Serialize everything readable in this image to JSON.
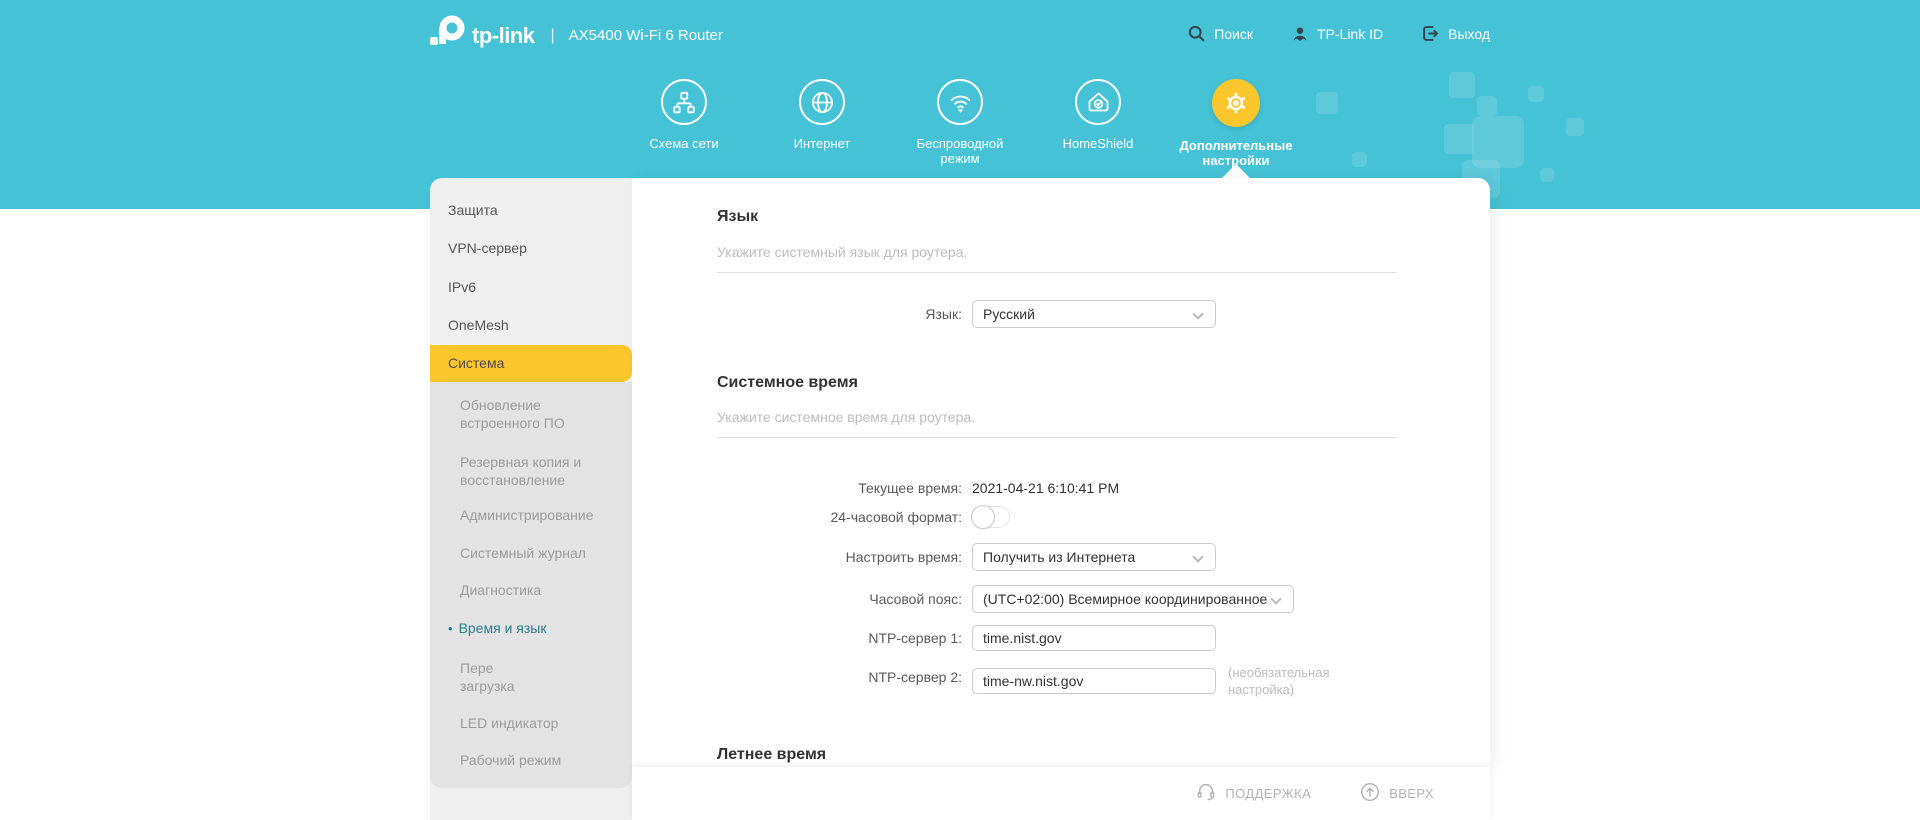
{
  "header": {
    "brand": "tp-link",
    "sep": "|",
    "model": "AX5400 Wi-Fi 6 Router",
    "search_label": "Поиск",
    "id_label": "TP-Link ID",
    "logout_label": "Выход"
  },
  "nav": {
    "items": [
      {
        "label": "Схема сети",
        "icon": "network-map-icon",
        "active": false
      },
      {
        "label": "Интернет",
        "icon": "globe-icon",
        "active": false
      },
      {
        "label": "Беспроводной режим",
        "icon": "wifi-icon",
        "active": false
      },
      {
        "label": "HomeShield",
        "icon": "home-shield-icon",
        "active": false
      },
      {
        "label": "Дополнительные настройки",
        "icon": "gear-icon",
        "active": true
      }
    ]
  },
  "sidebar": {
    "items": [
      "Защита",
      "VPN-сервер",
      "IPv6",
      "OneMesh",
      "Система"
    ],
    "active_item": "Система",
    "bullet": "•",
    "subitems": [
      "Обновление встроенного ПО",
      "Резервная копия и восстановление",
      "Администрирование",
      "Системный журнал",
      "Диагностика",
      "Время и язык",
      "Пере загрузка",
      "LED индикатор",
      "Рабочий режим"
    ],
    "active_subitem": "Время и язык"
  },
  "main": {
    "language": {
      "title": "Язык",
      "subtitle": "Укажите системный язык для роутера.",
      "label": "Язык:",
      "value": "Русский"
    },
    "time": {
      "title": "Системное время",
      "subtitle": "Укажите системное время для роутера.",
      "current_label": "Текущее время:",
      "current_value": "2021-04-21 6:10:41 PM",
      "format24_label": "24-часовой формат:",
      "format24_state": "off",
      "set_time_label": "Настроить время:",
      "set_time_value": "Получить из Интернета",
      "timezone_label": "Часовой пояс:",
      "timezone_value": "(UTC+02:00) Всемирное координированное",
      "ntp1_label": "NTP-сервер 1:",
      "ntp1_value": "time.nist.gov",
      "ntp2_label": "NTP-сервер 2:",
      "ntp2_value": "time-nw.nist.gov",
      "ntp2_note": "(необязательная настройка)"
    },
    "dst": {
      "title": "Летнее время"
    }
  },
  "footer": {
    "support_label": "ПОДДЕРЖКА",
    "top_label": "ВВЕРХ"
  },
  "colors": {
    "header_teal": "#45c2d5",
    "accent_yellow": "#fcc62d",
    "active_link_teal": "#2a7e8d"
  }
}
